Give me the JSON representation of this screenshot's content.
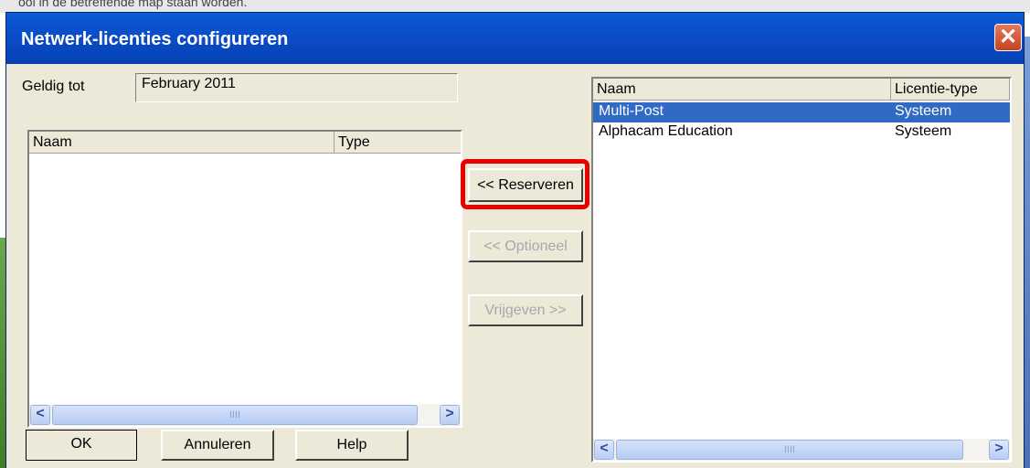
{
  "background_strip_text": "ooi in de betreffende map staan worden.",
  "window": {
    "title": "Netwerk-licenties configureren",
    "close_glyph": "✕"
  },
  "valid_until": {
    "label": "Geldig tot",
    "value": "February 2011"
  },
  "left_list": {
    "columns": [
      "Naam",
      "Type"
    ],
    "rows": []
  },
  "middle_buttons": {
    "reserve": "<< Reserveren",
    "optional": "<< Optioneel",
    "release": "Vrijgeven >>"
  },
  "right_list": {
    "columns": [
      "Naam",
      "Licentie-type"
    ],
    "rows": [
      {
        "name": "Multi-Post",
        "type": "Systeem",
        "selected": true
      },
      {
        "name": "Alphacam Education",
        "type": "Systeem",
        "selected": false
      }
    ]
  },
  "bottom_buttons": {
    "ok": "OK",
    "cancel": "Annuleren",
    "help": "Help"
  },
  "scrollbar": {
    "left_arrow": "<",
    "right_arrow": ">",
    "grip": "IIII"
  },
  "colors": {
    "title_bar": "#0a4ac4",
    "selection": "#316ac5",
    "highlight": "#e60000"
  }
}
